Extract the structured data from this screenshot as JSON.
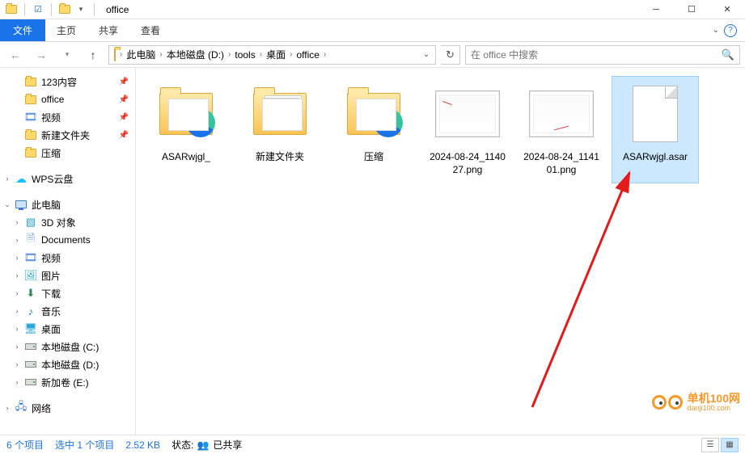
{
  "window": {
    "title": "office"
  },
  "ribbon": {
    "file": "文件",
    "tabs": [
      "主页",
      "共享",
      "查看"
    ]
  },
  "breadcrumbs": [
    "此电脑",
    "本地磁盘 (D:)",
    "tools",
    "桌面",
    "office"
  ],
  "search": {
    "placeholder": "在 office 中搜索"
  },
  "sidebar": {
    "quick": [
      {
        "label": "123内容",
        "icon": "folder",
        "pinned": true
      },
      {
        "label": "office",
        "icon": "folder",
        "pinned": true
      },
      {
        "label": "视频",
        "icon": "video",
        "pinned": true
      },
      {
        "label": "新建文件夹",
        "icon": "folder",
        "pinned": true
      },
      {
        "label": "压缩",
        "icon": "folder"
      }
    ],
    "wps": {
      "label": "WPS云盘"
    },
    "thispc": {
      "label": "此电脑"
    },
    "thispc_children": [
      {
        "label": "3D 对象",
        "icon": "3d"
      },
      {
        "label": "Documents",
        "icon": "docs"
      },
      {
        "label": "视频",
        "icon": "video"
      },
      {
        "label": "图片",
        "icon": "pictures"
      },
      {
        "label": "下载",
        "icon": "downloads"
      },
      {
        "label": "音乐",
        "icon": "music"
      },
      {
        "label": "桌面",
        "icon": "desktop"
      },
      {
        "label": "本地磁盘 (C:)",
        "icon": "drive"
      },
      {
        "label": "本地磁盘 (D:)",
        "icon": "drive"
      },
      {
        "label": "新加卷 (E:)",
        "icon": "drive"
      }
    ],
    "network": {
      "label": "网络"
    }
  },
  "files": [
    {
      "name": "ASARwjgl_",
      "type": "folder-edge"
    },
    {
      "name": "新建文件夹",
      "type": "folder-docs"
    },
    {
      "name": "压缩",
      "type": "folder-edge"
    },
    {
      "name": "2024-08-24_114027.png",
      "type": "png"
    },
    {
      "name": "2024-08-24_114101.png",
      "type": "png"
    },
    {
      "name": "ASARwjgl.asar",
      "type": "blank",
      "selected": true
    }
  ],
  "status": {
    "count": "6 个项目",
    "selection": "选中 1 个项目",
    "size": "2.52 KB",
    "state_label": "状态:",
    "state_value": "已共享"
  },
  "watermark": {
    "name": "单机100网",
    "url": "danji100.com"
  }
}
